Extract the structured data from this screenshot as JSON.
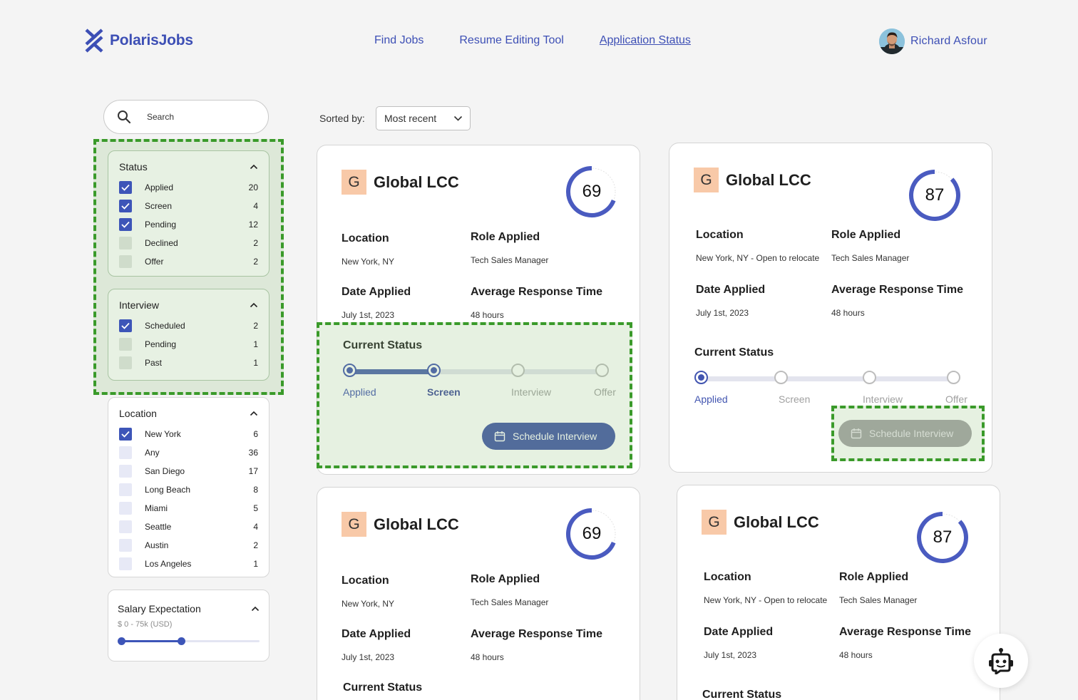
{
  "brand": {
    "name": "PolarisJobs",
    "color": "#3d4fb5"
  },
  "nav": [
    {
      "label": "Find Jobs",
      "active": false
    },
    {
      "label": "Resume Editing Tool",
      "active": false
    },
    {
      "label": "Application Status",
      "active": true
    }
  ],
  "user": {
    "name": "Richard Asfour"
  },
  "search": {
    "placeholder": "Search",
    "value": ""
  },
  "filters": {
    "status": {
      "title": "Status",
      "items": [
        {
          "label": "Applied",
          "count": "20",
          "checked": true
        },
        {
          "label": "Screen",
          "count": "4",
          "checked": true
        },
        {
          "label": "Pending",
          "count": "12",
          "checked": true
        },
        {
          "label": "Declined",
          "count": "2",
          "checked": false
        },
        {
          "label": "Offer",
          "count": "2",
          "checked": false
        }
      ]
    },
    "interview": {
      "title": "Interview",
      "items": [
        {
          "label": "Scheduled",
          "count": "2",
          "checked": true
        },
        {
          "label": "Pending",
          "count": "1",
          "checked": false
        },
        {
          "label": "Past",
          "count": "1",
          "checked": false
        }
      ]
    },
    "location": {
      "title": "Location",
      "items": [
        {
          "label": "New York",
          "count": "6",
          "checked": true
        },
        {
          "label": "Any",
          "count": "36",
          "checked": false
        },
        {
          "label": "San Diego",
          "count": "17",
          "checked": false
        },
        {
          "label": "Long Beach",
          "count": "8",
          "checked": false
        },
        {
          "label": "Miami",
          "count": "5",
          "checked": false
        },
        {
          "label": "Seattle",
          "count": "4",
          "checked": false
        },
        {
          "label": "Austin",
          "count": "2",
          "checked": false
        },
        {
          "label": "Los Angeles",
          "count": "1",
          "checked": false
        }
      ]
    },
    "salary": {
      "title": "Salary Expectation",
      "range_label": "$ 0 - 75k (USD)",
      "slider_min": 0,
      "slider_max": 0.45
    }
  },
  "sort": {
    "label": "Sorted by:",
    "value": "Most recent"
  },
  "labels": {
    "location": "Location",
    "role": "Role Applied",
    "date": "Date Applied",
    "response": "Average Response Time",
    "current_status": "Current Status",
    "schedule_button": "Schedule Interview"
  },
  "steps": [
    "Applied",
    "Screen",
    "Interview",
    "Offer"
  ],
  "cards": [
    {
      "initial": "G",
      "company": "Global LCC",
      "score": "69",
      "score_fraction": 0.69,
      "location": "New York, NY",
      "role": "Tech Sales Manager",
      "date": "July 1st, 2023",
      "response": "48 hours",
      "status_index": 1,
      "button_enabled": true
    },
    {
      "initial": "G",
      "company": "Global LCC",
      "score": "87",
      "score_fraction": 0.87,
      "location": "New York, NY - Open to relocate",
      "role": "Tech Sales Manager",
      "date": "July 1st, 2023",
      "response": "48 hours",
      "status_index": 0,
      "button_enabled": false
    },
    {
      "initial": "G",
      "company": "Global LCC",
      "score": "69",
      "score_fraction": 0.69,
      "location": "New York, NY",
      "role": "Tech Sales Manager",
      "date": "July 1st, 2023",
      "response": "48 hours"
    },
    {
      "initial": "G",
      "company": "Global LCC",
      "score": "87",
      "score_fraction": 0.87,
      "location": "New York, NY - Open to relocate",
      "role": "Tech Sales Manager",
      "date": "July 1st, 2023",
      "response": "48 hours"
    }
  ]
}
